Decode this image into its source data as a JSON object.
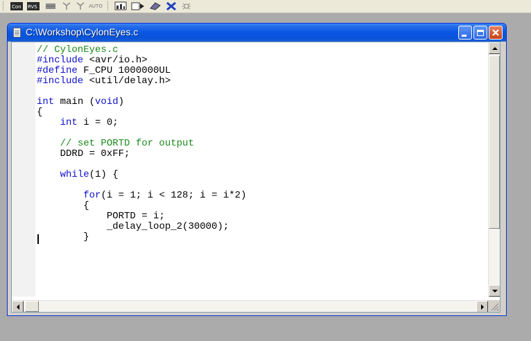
{
  "toolbar": {
    "icons": [
      "compile-icon",
      "build-icon",
      "make-icon",
      "tree-icon",
      "tree-icon",
      "auto-icon",
      "chart-icon",
      "arrow-icon",
      "paint-icon",
      "delete-icon",
      "debug-icon"
    ],
    "label1": "Con",
    "label2": "RVS",
    "label3": "AUTO"
  },
  "window": {
    "title": "C:\\Workshop\\CylonEyes.c",
    "icon": "document-icon",
    "controls": [
      "minimize-icon",
      "maximize-icon",
      "close-icon"
    ]
  },
  "code": {
    "line1": "// CylonEyes.c",
    "line2_kw": "#include",
    "line2_rest": " <avr/io.h>",
    "line3_kw": "#define",
    "line3_rest": " F_CPU 1000000UL",
    "line4_kw": "#include",
    "line4_rest": " <util/delay.h>",
    "line6_kw": "int",
    "line6_rest": " main (",
    "line6_kw2": "void",
    "line6_end": ")",
    "line7": "{",
    "line8_kw": "int",
    "line8_rest": " i = 0;",
    "line10": "// set PORTD for output",
    "line11": "DDRD = 0xFF;",
    "line13_kw": "while",
    "line13_rest": "(1) {",
    "line15_kw": "for",
    "line15_rest": "(i = 1; i < 128; i = i*2)",
    "line16": "{",
    "line17": "PORTD = i;",
    "line18": "_delay_loop_2(30000);",
    "line19": "}"
  },
  "colors": {
    "comment": "#1a8a1a",
    "keyword": "#1010cc",
    "titlebar": "#0853da",
    "close": "#c44217"
  }
}
